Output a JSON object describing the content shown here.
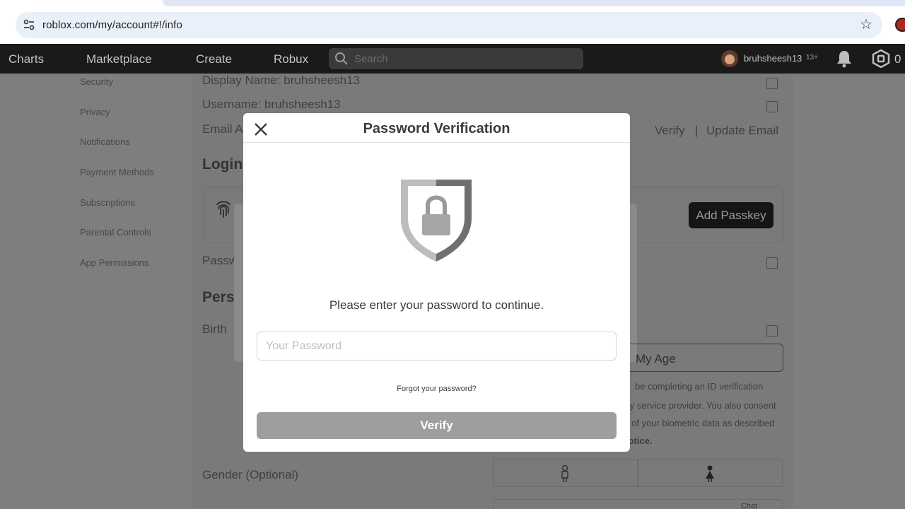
{
  "browser": {
    "url": "roblox.com/my/account#!/info"
  },
  "nav": {
    "links": [
      "Charts",
      "Marketplace",
      "Create",
      "Robux"
    ],
    "search_placeholder": "Search",
    "username": "bruhsheesh13",
    "age_badge": "13+",
    "robux_count": "0"
  },
  "sidebar": {
    "items": [
      "Security",
      "Privacy",
      "Notifications",
      "Payment Methods",
      "Subscriptions",
      "Parental Controls",
      "App Permissions"
    ]
  },
  "account": {
    "display_name_row": "Display Name:  bruhsheesh13",
    "username_row": "Username: bruhsheesh13",
    "email_label": "Email A",
    "verify_link": "Verify",
    "separator": "|",
    "update_email_link": "Update Email",
    "login_heading": "Login",
    "add_passkey_label": "Add Passkey",
    "password_label": "Passw",
    "personal_heading": "Perso",
    "birthday_label": "Birth",
    "age_button_label": "My Age",
    "consent_lines": [
      "be completing an ID verification",
      "ly service provider. You also consent",
      "of your biometric data as described",
      "lotice."
    ],
    "gender_label": "Gender (Optional)",
    "chat_label": "Chat"
  },
  "modal": {
    "title": "Password Verification",
    "message": "Please enter your password to continue.",
    "password_placeholder": "Your Password",
    "password_value": "",
    "forgot_link": "Forgot your password?",
    "verify_label": "Verify"
  }
}
